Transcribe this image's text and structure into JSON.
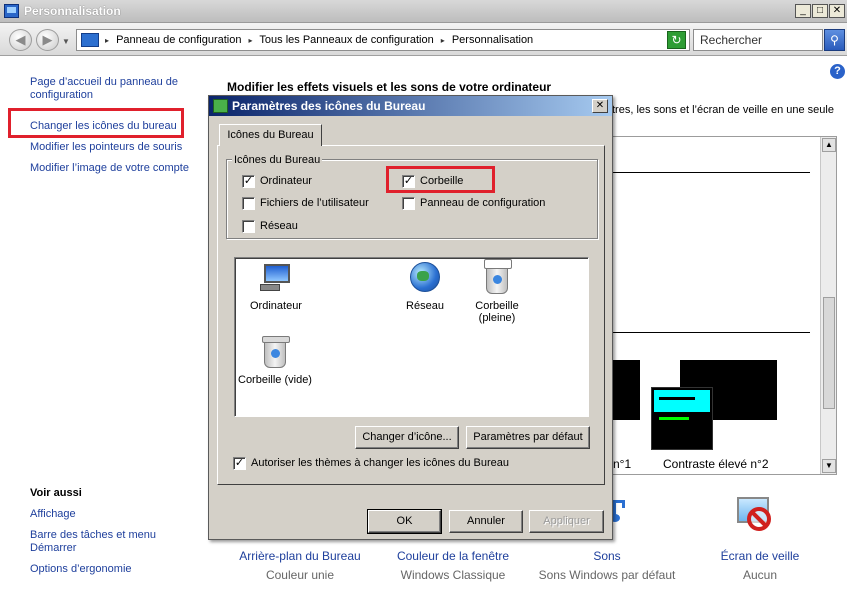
{
  "window": {
    "title": "Personnalisation",
    "caption_buttons": [
      "_",
      "□",
      "✕"
    ]
  },
  "address_bar": {
    "crumbs": [
      "Panneau de configuration",
      "Tous les Panneaux de configuration",
      "Personnalisation"
    ],
    "search_placeholder": "Rechercher"
  },
  "left_nav": {
    "links": [
      "Page d’accueil du panneau de configuration",
      "Changer les icônes du bureau",
      "Modifier les pointeurs de souris",
      "Modifier l’image de votre compte"
    ],
    "see_also_title": "Voir aussi",
    "see_also": [
      "Affichage",
      "Barre des tâches et menu Démarrer",
      "Options d’ergonomie"
    ]
  },
  "main": {
    "title": "Modifier les effets visuels et les sons de votre ordinateur",
    "desc_fragment": "tres, les sons et l’écran de veille en une seule",
    "theme_captions": [
      "n°1",
      "Contraste élevé n°2"
    ],
    "bottom_items": [
      {
        "label": "Arrière-plan du Bureau",
        "sub": "Couleur unie",
        "icon": "desktop-background-icon"
      },
      {
        "label": "Couleur de la fenêtre",
        "sub": "Windows Classique",
        "icon": "window-color-icon"
      },
      {
        "label": "Sons",
        "sub": "Sons Windows par défaut",
        "icon": "sounds-icon"
      },
      {
        "label": "Écran de veille",
        "sub": "Aucun",
        "icon": "screensaver-icon"
      }
    ]
  },
  "dialog": {
    "title": "Paramètres des icônes du Bureau",
    "tab": "Icônes du Bureau",
    "group_label": "Icônes du Bureau",
    "checkboxes": [
      {
        "label": "Ordinateur",
        "checked": true
      },
      {
        "label": "Corbeille",
        "checked": true
      },
      {
        "label": "Fichiers de l’utilisateur",
        "checked": false
      },
      {
        "label": "Panneau de configuration",
        "checked": false
      },
      {
        "label": "Réseau",
        "checked": false
      }
    ],
    "icons": [
      {
        "label": "Ordinateur",
        "icon": "computer-icon"
      },
      {
        "label": "Réseau",
        "icon": "network-icon"
      },
      {
        "label": "Corbeille (pleine)",
        "icon": "recycle-bin-full-icon"
      },
      {
        "label": "Corbeille (vide)",
        "icon": "recycle-bin-empty-icon"
      }
    ],
    "change_icon_btn": "Changer d’icône...",
    "default_btn": "Paramètres par défaut",
    "allow_themes_label": "Autoriser les thèmes à changer les icônes du Bureau",
    "allow_themes_checked": true,
    "ok_btn": "OK",
    "cancel_btn": "Annuler",
    "apply_btn": "Appliquer"
  },
  "colors": {
    "highlight_red": "#e0202c",
    "link_blue": "#1e3f9c",
    "contrast_cyan": "#00ffff",
    "contrast_green": "#00ff00"
  }
}
